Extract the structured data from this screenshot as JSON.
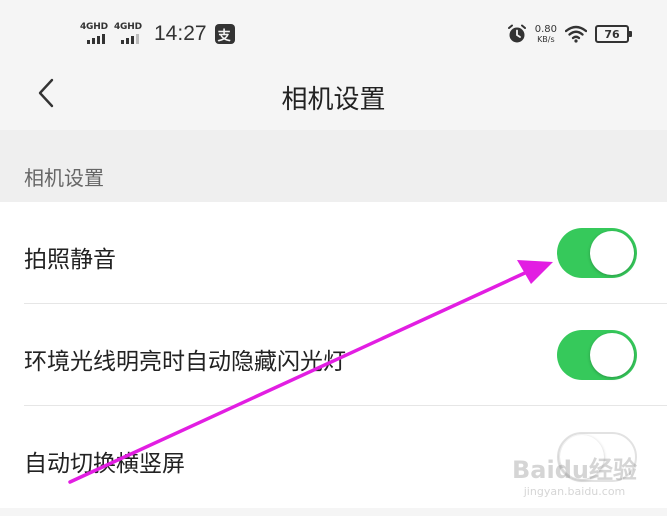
{
  "status_bar": {
    "net1_label": "4GHD",
    "net2_label": "4GHD",
    "time": "14:27",
    "speed_value": "0.80",
    "speed_unit": "KB/s",
    "battery": "76"
  },
  "nav": {
    "title": "相机设置"
  },
  "section": {
    "title": "相机设置"
  },
  "settings": [
    {
      "label": "拍照静音",
      "enabled": true
    },
    {
      "label": "环境光线明亮时自动隐藏闪光灯",
      "enabled": true
    },
    {
      "label": "自动切换横竖屏",
      "enabled": false
    }
  ],
  "watermark": {
    "main": "Baidu经验",
    "sub": "jingyan.baidu.com"
  },
  "colors": {
    "toggle_on": "#36c95b",
    "annotation_arrow": "#e21ee2"
  }
}
